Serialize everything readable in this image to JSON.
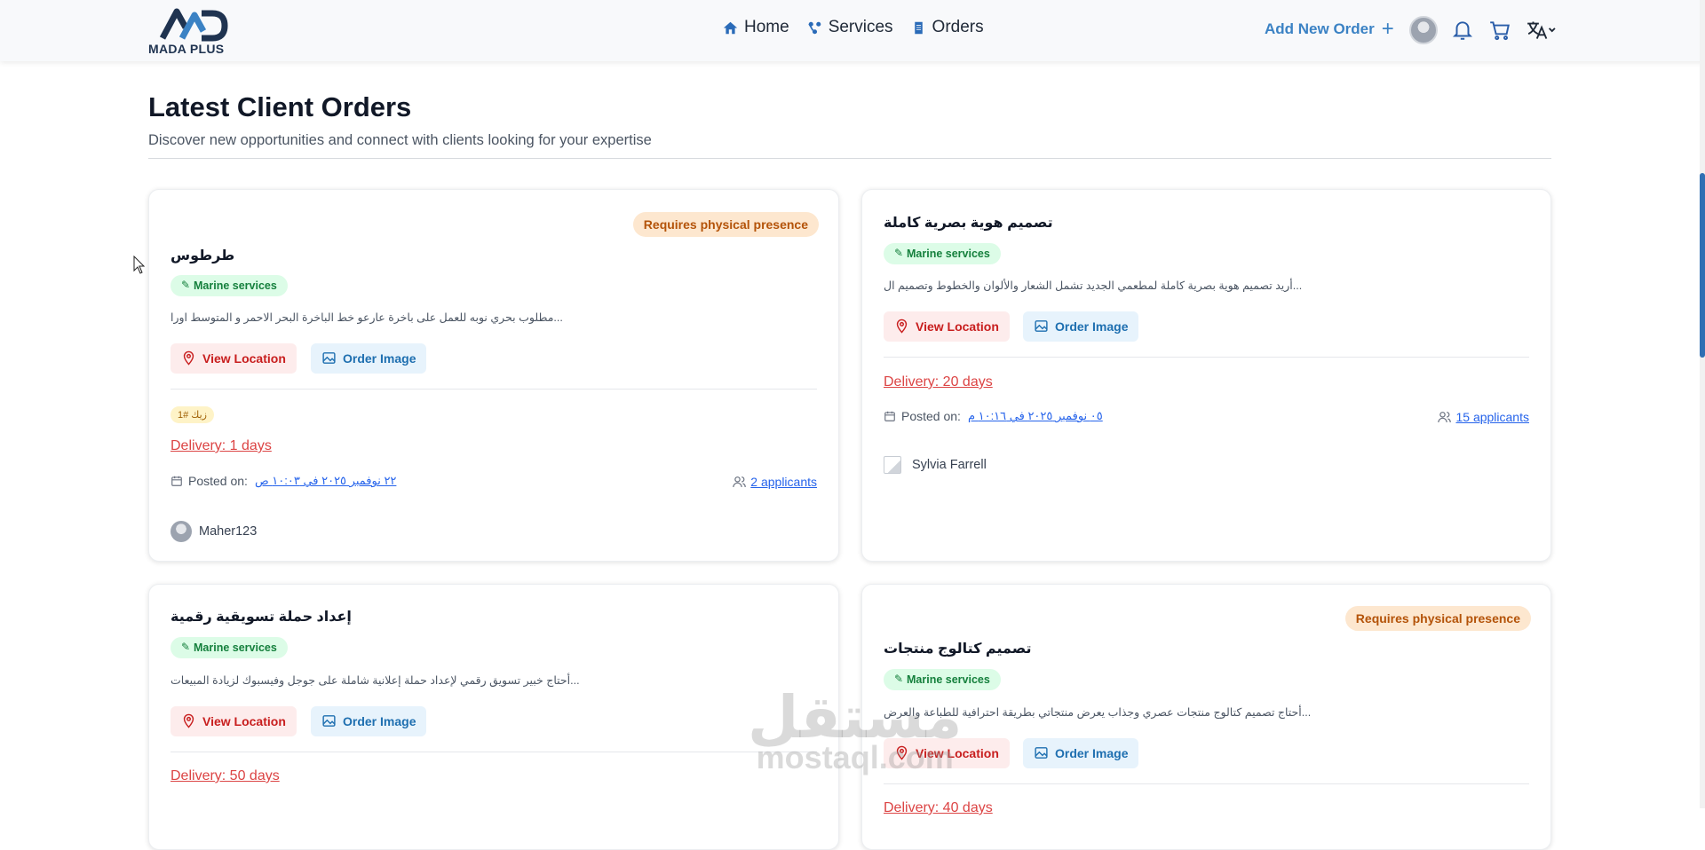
{
  "header": {
    "logo_text": "MADA PLUS",
    "nav": [
      {
        "label": "Home",
        "icon": "home-icon"
      },
      {
        "label": "Services",
        "icon": "services-icon"
      },
      {
        "label": "Orders",
        "icon": "orders-icon"
      }
    ],
    "add_order_label": "Add New Order",
    "add_order_icon": "plus-icon"
  },
  "page": {
    "title": "Latest Client Orders",
    "subtitle": "Discover new opportunities and connect with clients looking for your expertise"
  },
  "common": {
    "location_label": "View Location",
    "image_label": "Order Image",
    "posted_label": "Posted on:"
  },
  "orders": [
    {
      "title": "طرطوس",
      "badge": "Requires physical presence",
      "tag": "Marine services",
      "description": "مطلوب بحري نوبه للعمل على باخرة عارعو خط الباخرة البحر الاحمر و المتوسط اورا...",
      "hash_tag": "زيك #1",
      "delivery": "Delivery: 1 days",
      "posted_date": "٢٢ نوفمبر ٢٠٢٥ في ١٠:٠٣ ص",
      "applicants": "2 applicants",
      "user": "Maher123"
    },
    {
      "title": "تصميم هوية بصرية كاملة",
      "tag": "Marine services",
      "description": "أريد تصميم هوية بصرية كاملة لمطعمي الجديد تشمل الشعار والألوان والخطوط وتصميم ال...",
      "delivery": "Delivery: 20 days",
      "posted_date": "٠٥ نوفمبر ٢٠٢٥ في ١٠:١٦ م",
      "applicants": "15 applicants",
      "user": "Sylvia Farrell"
    },
    {
      "title": "إعداد حملة تسويقية رقمية",
      "tag": "Marine services",
      "description": "أحتاج خبير تسويق رقمي لإعداد حملة إعلانية شاملة على جوجل وفيسبوك لزيادة المبيعات...",
      "delivery": "Delivery: 50 days"
    },
    {
      "title": "تصميم كتالوج منتجات",
      "badge": "Requires physical presence",
      "tag": "Marine services",
      "description": "أحتاج تصميم كتالوج منتجات عصري وجذاب يعرض منتجاتي بطريقة احترافية للطباعة والعرض...",
      "delivery": "Delivery: 40 days"
    }
  ],
  "watermark": {
    "arabic": "مستقل",
    "latin": "mostaql.com"
  },
  "colors": {
    "accent_blue": "#2a6bb8",
    "location_red": "#c81e1e",
    "tag_green": "#15803d",
    "badge_orange": "#b45309",
    "delivery_red": "#dc4444"
  }
}
